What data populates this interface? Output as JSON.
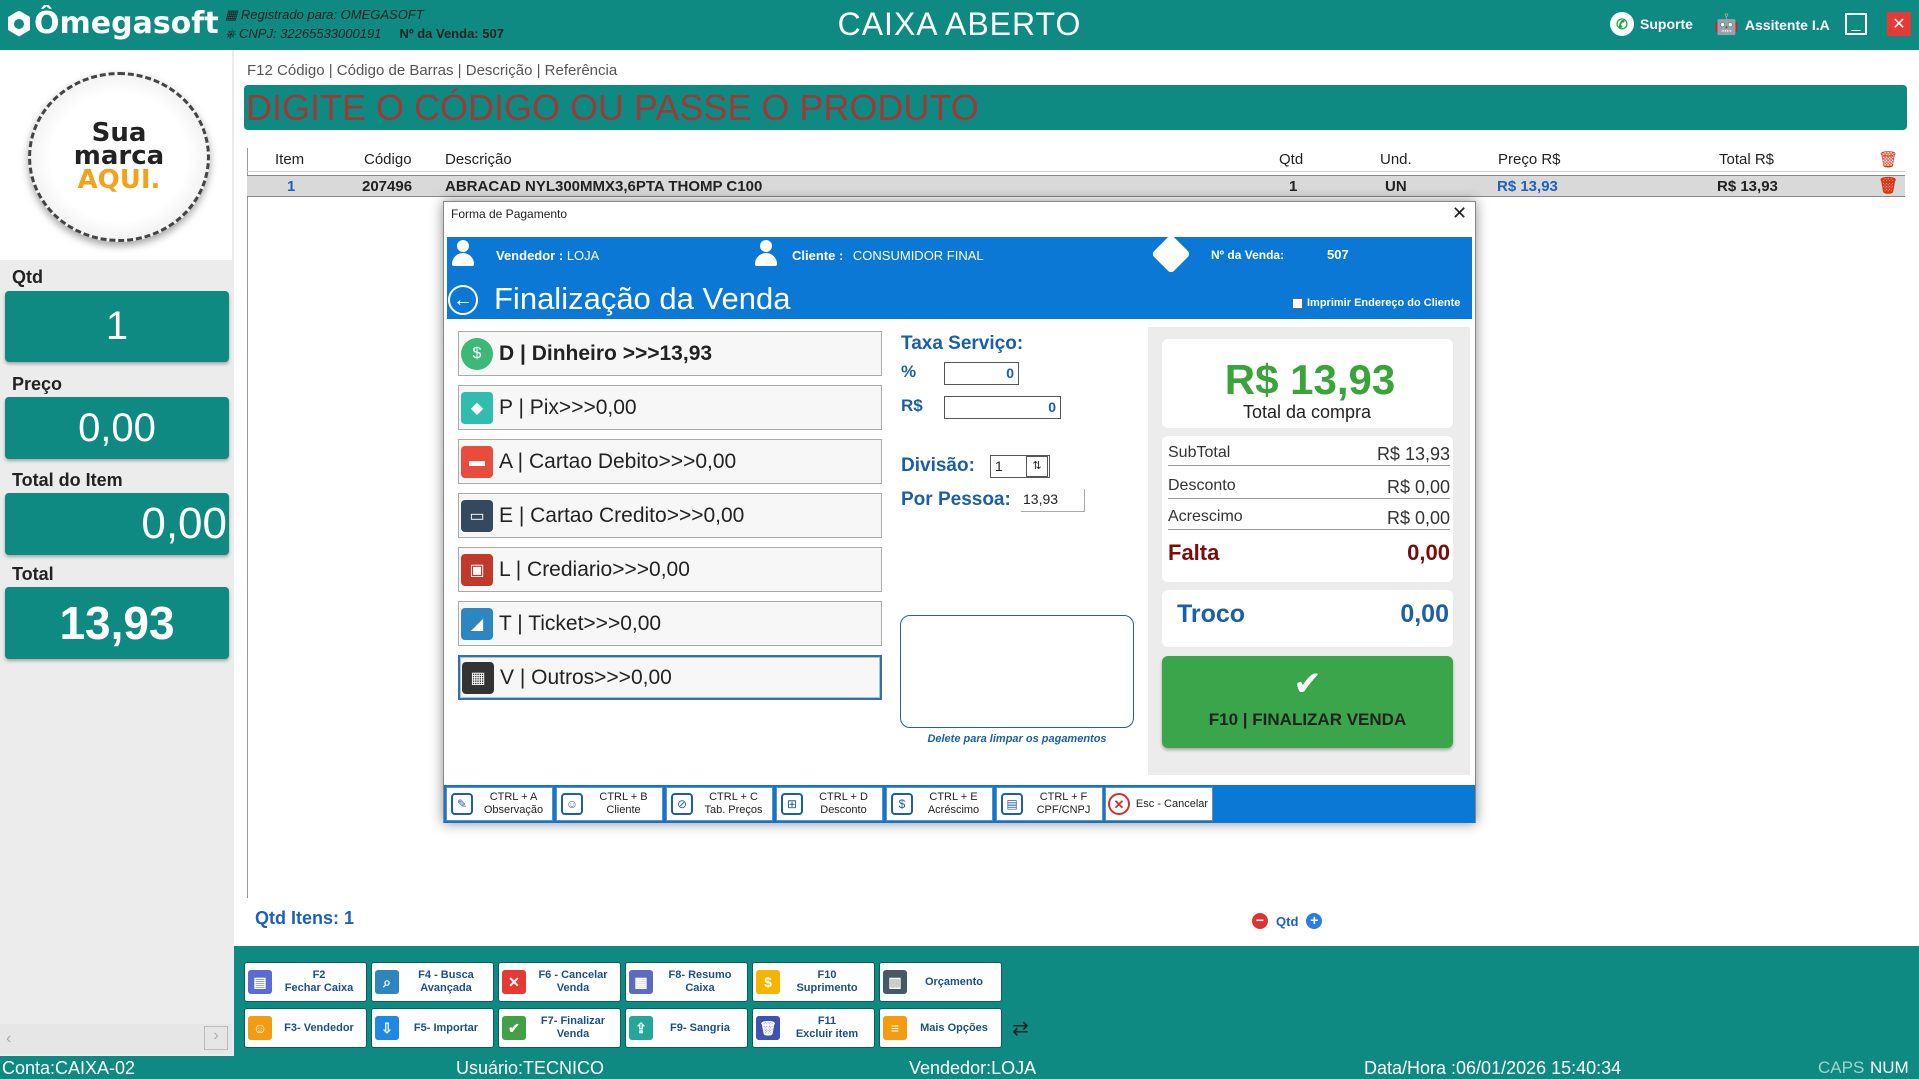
{
  "titlebar": {
    "logo": "Ômegasoft",
    "registered": "Registrado para: OMEGASOFT",
    "cnpj": "CNPJ: 32265533000191",
    "sale_no_label": "Nº da Venda:",
    "sale_no": "507",
    "title": "CAIXA ABERTO",
    "support": "Suporte",
    "assistant": "Assitente I.A",
    "brand_color": "#0e8a82"
  },
  "left": {
    "brand_line1": "Sua",
    "brand_line2": "marca",
    "brand_line3": "AQUI.",
    "qtd_label": "Qtd",
    "qtd_value": "1",
    "preco_label": "Preço",
    "preco_value": "0,00",
    "total_item_label": "Total do Item",
    "total_item_value": "0,00",
    "total_label": "Total",
    "total_value": "13,93"
  },
  "search": {
    "hint": "F12  Código | Código de Barras | Descrição | Referência",
    "placeholder": "DIGITE O CÓDIGO OU PASSE O PRODUTO"
  },
  "grid": {
    "headers": {
      "item": "Item",
      "codigo": "Código",
      "descricao": "Descrição",
      "qtd": "Qtd",
      "und": "Und.",
      "preco": "Preço R$",
      "total": "Total R$"
    },
    "rows": [
      {
        "item": "1",
        "codigo": "207496",
        "descricao": "ABRACAD NYL300MMX3,6PTA THOMP C100",
        "qtd": "1",
        "und": "UN",
        "preco": "R$ 13,93",
        "total": "R$ 13,93"
      }
    ],
    "qtd_itens": "Qtd Itens: 1",
    "qtd_ctl": "Qtd"
  },
  "modal": {
    "title": "Forma de Pagamento",
    "vendedor_label": "Vendedor :",
    "vendedor": "LOJA",
    "cliente_label": "Cliente :",
    "cliente": "CONSUMIDOR FINAL",
    "venda_label": "Nº da Venda:",
    "venda": "507",
    "heading": "Finalização da Venda",
    "print_opt": "Imprimir Endereço do Cliente",
    "payments": [
      {
        "key": "D",
        "text": "D | Dinheiro >>>13,93",
        "icon": "money-icon",
        "color": "#3cb878"
      },
      {
        "key": "P",
        "text": "P | Pix>>>0,00",
        "icon": "pix-icon",
        "color": "#32bcad"
      },
      {
        "key": "A",
        "text": "A | Cartao Debito>>>0,00",
        "icon": "debit-card-icon",
        "color": "#e74c3c"
      },
      {
        "key": "E",
        "text": "E | Cartao Credito>>>0,00",
        "icon": "credit-card-icon",
        "color": "#34495e"
      },
      {
        "key": "L",
        "text": "L | Crediario>>>0,00",
        "icon": "wallet-icon",
        "color": "#c0392b"
      },
      {
        "key": "T",
        "text": "T | Ticket>>>0,00",
        "icon": "ticket-icon",
        "color": "#2e86c1"
      },
      {
        "key": "V",
        "text": "V | Outros>>>0,00",
        "icon": "grid-icon",
        "color": "#333333"
      }
    ],
    "taxa_label": "Taxa Serviço:",
    "pct_label": "%",
    "pct_value": "0",
    "rs_label": "R$",
    "rs_value": "0",
    "divisao_label": "Divisão:",
    "divisao_value": "1",
    "por_pessoa_label": "Por Pessoa:",
    "por_pessoa_value": "13,93",
    "delete_hint": "Delete para limpar os pagamentos",
    "total_big": "R$ 13,93",
    "total_label": "Total da compra",
    "subtotal_label": "SubTotal",
    "subtotal": "R$ 13,93",
    "desconto_label": "Desconto",
    "desconto": "R$ 0,00",
    "acrescimo_label": "Acrescimo",
    "acrescimo": "R$ 0,00",
    "falta_label": "Falta",
    "falta": "0,00",
    "troco_label": "Troco",
    "troco": "0,00",
    "finalizar": "F10 |  FINALIZAR VENDA",
    "footer": [
      {
        "l1": "CTRL + A",
        "l2": "Observação",
        "icon": "note-icon"
      },
      {
        "l1": "CTRL + B",
        "l2": "Cliente",
        "icon": "user-icon"
      },
      {
        "l1": "CTRL + C",
        "l2": "Tab. Preços",
        "icon": "price-tag-icon"
      },
      {
        "l1": "CTRL + D",
        "l2": "Desconto",
        "icon": "cart-discount-icon"
      },
      {
        "l1": "CTRL + E",
        "l2": "Acréscimo",
        "icon": "coin-plus-icon"
      },
      {
        "l1": "CTRL + F",
        "l2": "CPF/CNPJ",
        "icon": "id-card-icon"
      }
    ],
    "cancel": "Esc - Cancelar"
  },
  "toolbar": {
    "row1": [
      {
        "label": "F2\nFechar Caixa",
        "icon": "cash-register-icon",
        "color": "#5b6bd6"
      },
      {
        "label": "F4 - Busca\nAvançada",
        "icon": "search-icon",
        "color": "#2e86c1"
      },
      {
        "label": "F6 - Cancelar\nVenda",
        "icon": "cancel-icon",
        "color": "#e53935"
      },
      {
        "label": "F8- Resumo\nCaixa",
        "icon": "report-icon",
        "color": "#5c6bc0"
      },
      {
        "label": "F10\nSuprimento",
        "icon": "money-bag-icon",
        "color": "#f5b400"
      },
      {
        "label": "Orçamento",
        "icon": "budget-icon",
        "color": "#455a64"
      }
    ],
    "row2": [
      {
        "label": "F3- Vendedor",
        "icon": "seller-icon",
        "color": "#f39c12"
      },
      {
        "label": "F5- Importar",
        "icon": "import-icon",
        "color": "#1e88e5"
      },
      {
        "label": "F7- Finalizar\nVenda",
        "icon": "check-icon",
        "color": "#43a047"
      },
      {
        "label": "F9- Sangria",
        "icon": "withdraw-icon",
        "color": "#26a69a"
      },
      {
        "label": "F11\nExcluir item",
        "icon": "trash-icon",
        "color": "#3f51b5"
      },
      {
        "label": "Mais Opções",
        "icon": "more-options-icon",
        "color": "#f39c12"
      }
    ]
  },
  "status": {
    "conta": "Conta:CAIXA-02",
    "usuario": "Usuário:TECNICO",
    "vendedor": "Vendedor:LOJA",
    "datahora": "Data/Hora :06/01/2026 15:40:34",
    "caps": "CAPS",
    "num": "NUM"
  }
}
